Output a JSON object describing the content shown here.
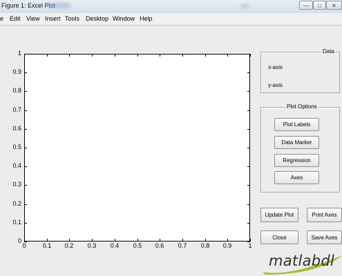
{
  "window": {
    "title": "Figure 1: Excel Plot",
    "controls": {
      "minimize": "—",
      "maximize": "□",
      "close": "✕"
    }
  },
  "menu": [
    "e",
    "Edit",
    "View",
    "Insert",
    "Tools",
    "Desktop",
    "Window",
    "Help"
  ],
  "axes": {
    "y_ticks": [
      "1",
      "0.9",
      "0.8",
      "0.7",
      "0.6",
      "0.5",
      "0.4",
      "0.3",
      "0.2",
      "0.1",
      "0"
    ],
    "x_ticks": [
      "0",
      "0.1",
      "0.2",
      "0.3",
      "0.4",
      "0.5",
      "0.6",
      "0.7",
      "0.8",
      "0.9",
      "1"
    ],
    "xlim": [
      0,
      1
    ],
    "ylim": [
      0,
      1
    ]
  },
  "data_panel": {
    "title": "Data",
    "x_label": "x-axis",
    "y_label": "y-axis"
  },
  "plot_options": {
    "title": "Plot Options",
    "buttons": [
      "Plot Labels",
      "Data Marker",
      "Regression",
      "Axes"
    ]
  },
  "actions": {
    "update_plot": "Update Plot",
    "print_axes": "Print Axes",
    "close": "Close",
    "save_axes": "Save Axes"
  },
  "logo": {
    "text": "matlabdl",
    "swoosh_color": "#9bbf2a"
  }
}
